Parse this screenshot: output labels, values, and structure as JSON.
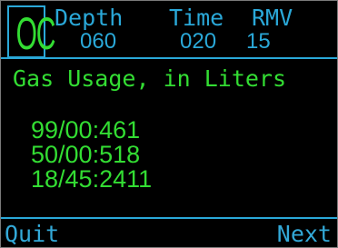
{
  "mode": "OC",
  "header": {
    "depth_label": "Depth",
    "time_label": "Time",
    "rmv_label": "RMV",
    "depth_value": "060",
    "time_value": "020",
    "rmv_value": "15"
  },
  "title": "Gas Usage, in Liters",
  "gas_usage": [
    "99/00:461",
    "50/00:518",
    "18/45:2411"
  ],
  "buttons": {
    "quit": "Quit",
    "next": "Next"
  },
  "colors": {
    "accent": "#2aa8d8",
    "text": "#33dd33",
    "background": "#000000"
  }
}
